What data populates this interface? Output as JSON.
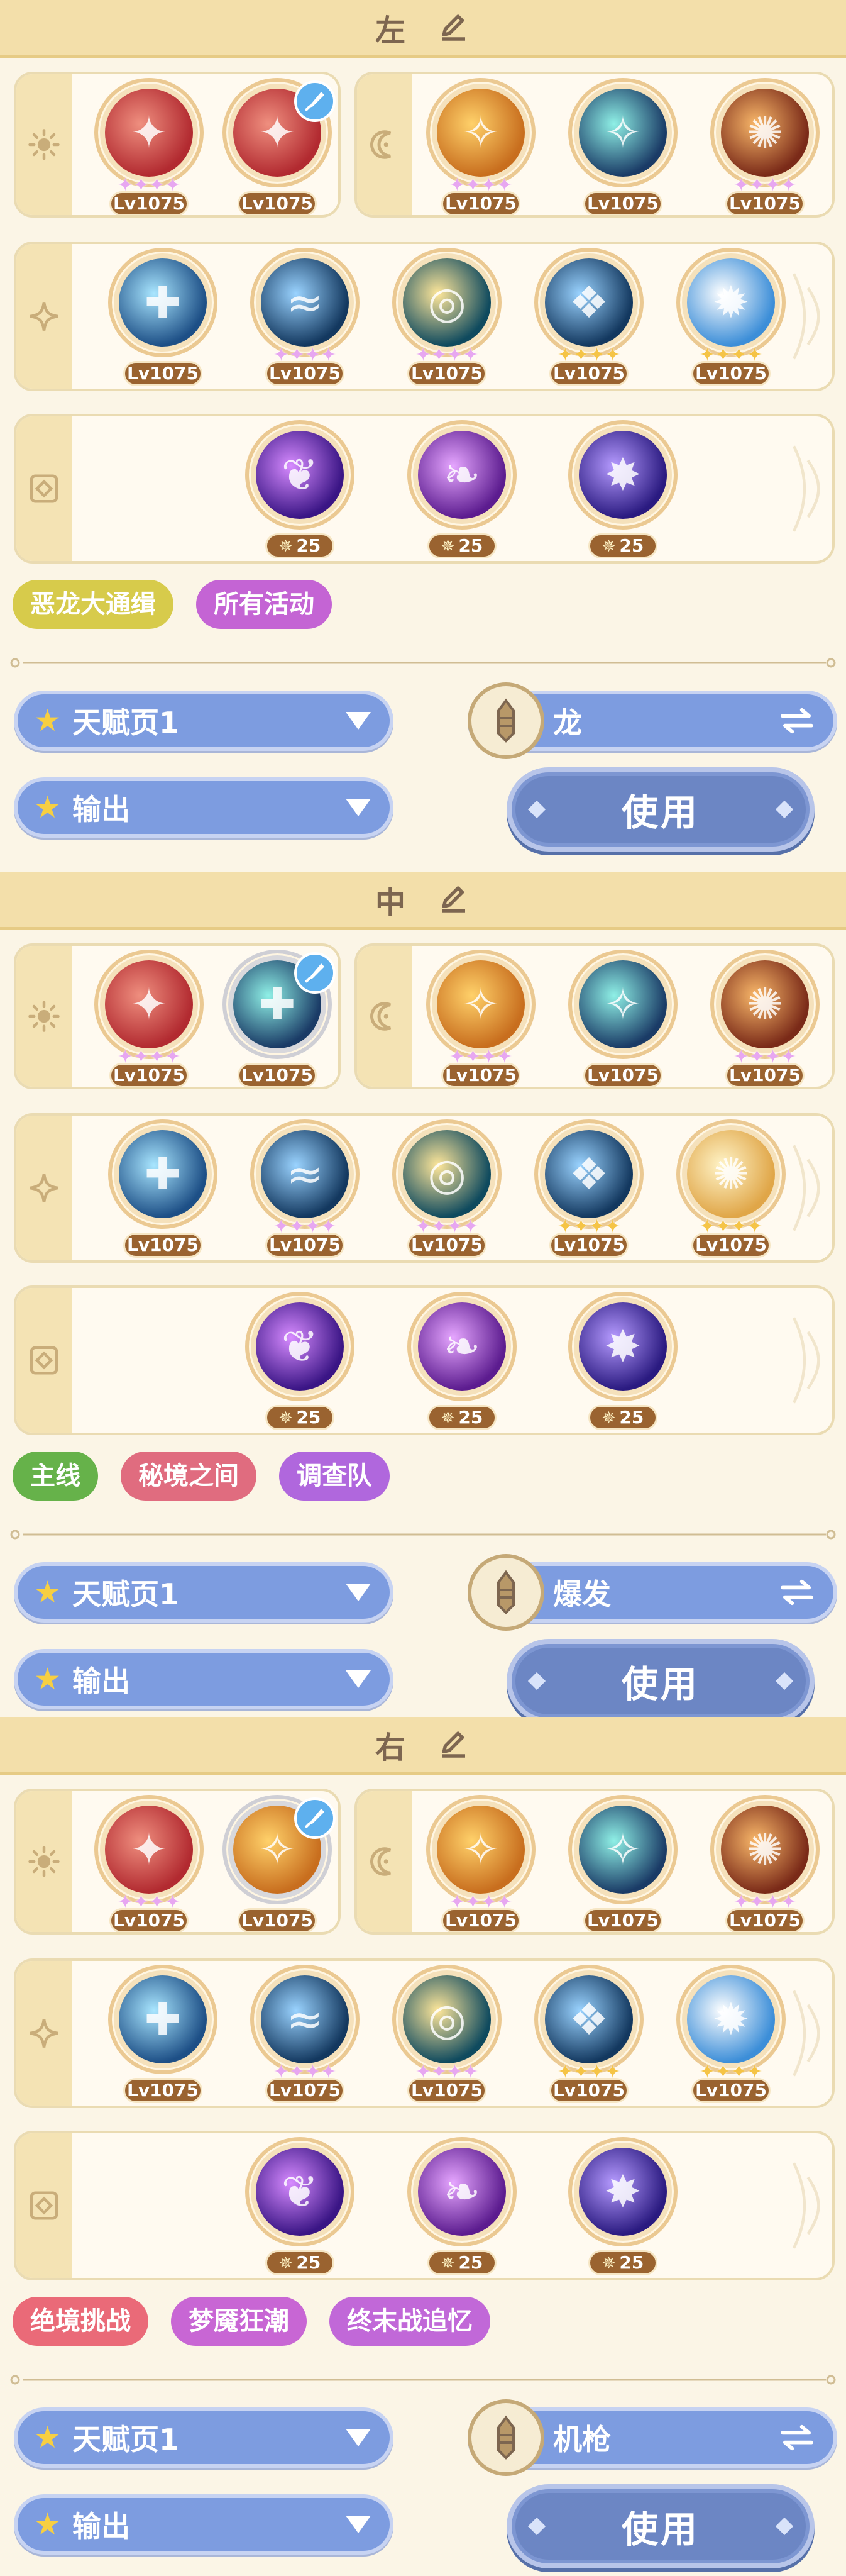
{
  "sections": [
    {
      "title": "左",
      "tags": [
        {
          "label": "恶龙大通缉",
          "color": "#d7cb4b"
        },
        {
          "label": "所有活动",
          "color": "#c464d4"
        }
      ],
      "talent_page": "天赋页1",
      "mode": "输出",
      "weapon": "龙",
      "use_label": "使用"
    },
    {
      "title": "中",
      "tags": [
        {
          "label": "主线",
          "color": "#66b24a"
        },
        {
          "label": "秘境之间",
          "color": "#e06c7f"
        },
        {
          "label": "调查队",
          "color": "#b067dd"
        }
      ],
      "talent_page": "天赋页1",
      "mode": "输出",
      "weapon": "爆发",
      "use_label": "使用"
    },
    {
      "title": "右",
      "tags": [
        {
          "label": "绝境挑战",
          "color": "#ea6a78"
        },
        {
          "label": "梦魇狂潮",
          "color": "#c866d4"
        },
        {
          "label": "终末战追忆",
          "color": "#c168d8"
        }
      ],
      "talent_page": "天赋页1",
      "mode": "输出",
      "weapon": "机枪",
      "use_label": "使用"
    }
  ],
  "level_label": "Lv1075",
  "relic_level": "25",
  "icons": {
    "sun_row": "sun-icon",
    "moon_row": "moon-icon",
    "sparkle_row": "sparkle-icon",
    "relic_row": "relic-icon",
    "edit": "edit-icon",
    "swap": "swap-arrows-icon",
    "badge": "sword-badge-icon"
  }
}
